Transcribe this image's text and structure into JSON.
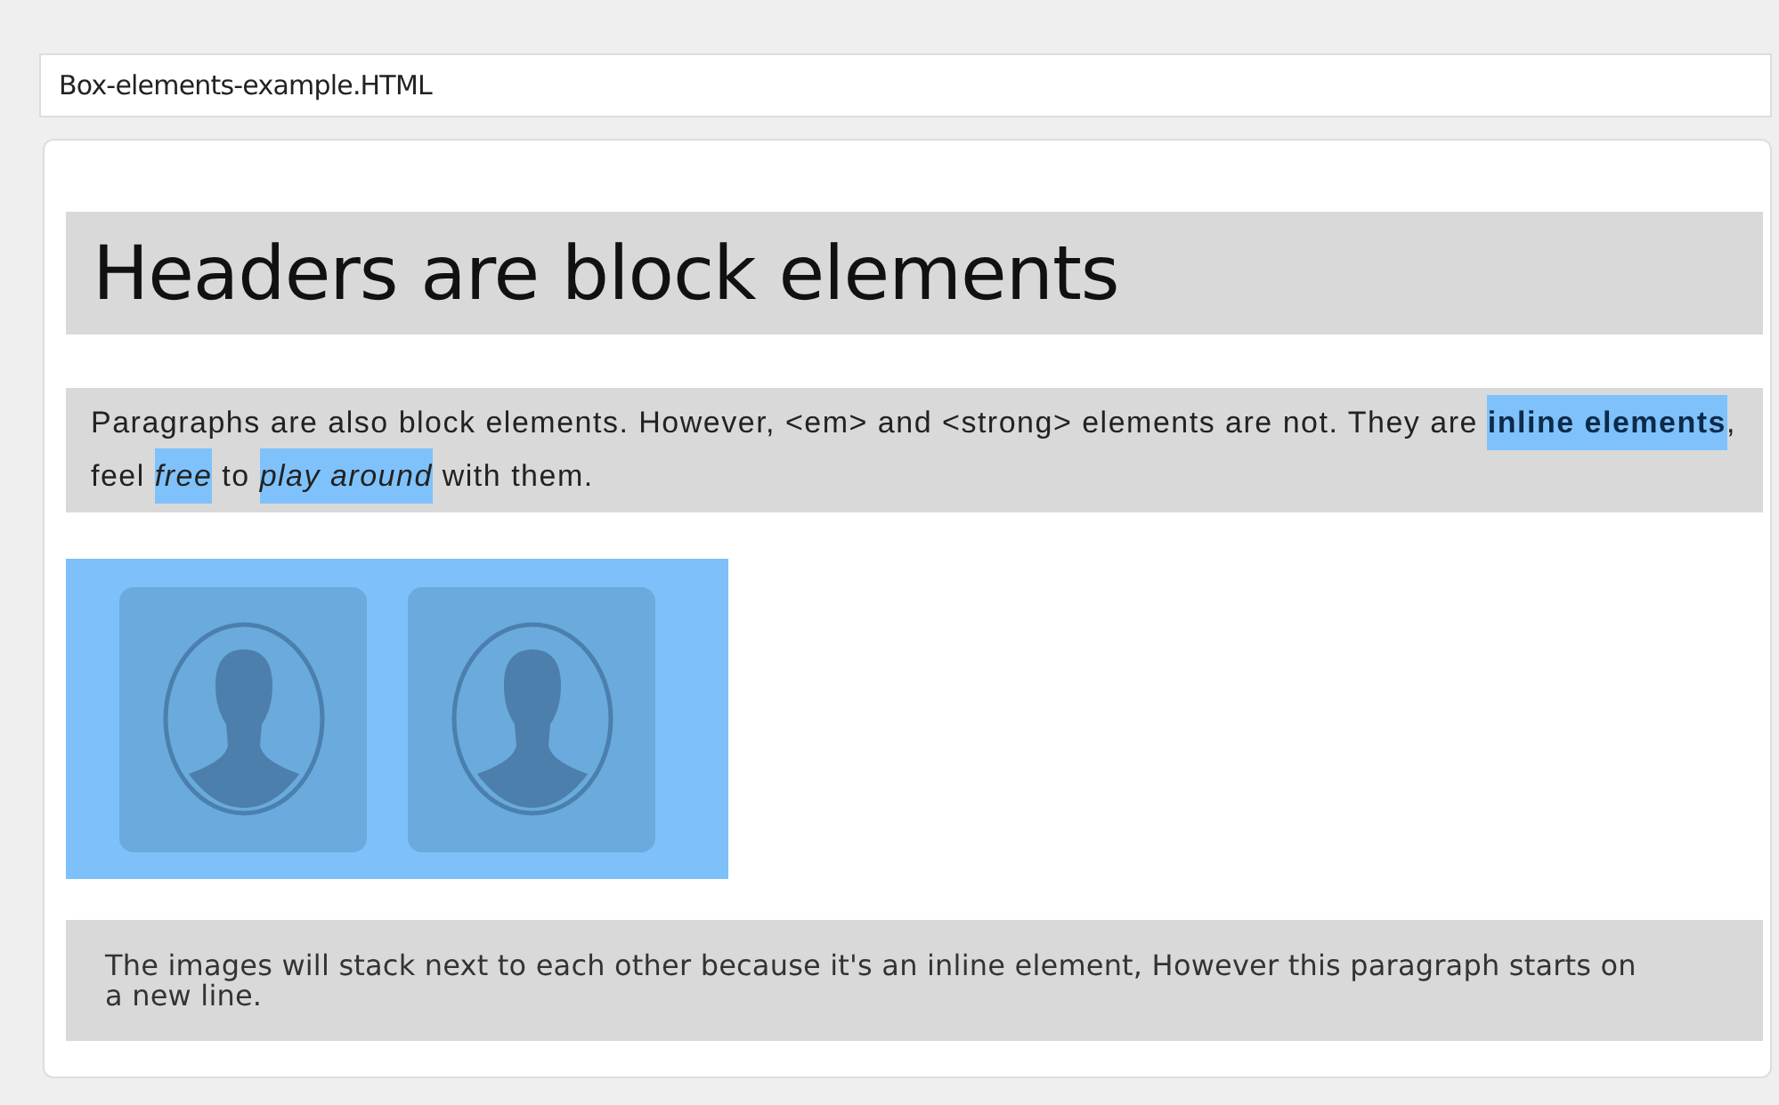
{
  "file_bar": {
    "title": "Box-elements-example.HTML"
  },
  "heading": "Headers are block elements",
  "paragraph": [
    {
      "text": "Paragraphs are also block elements. However, <em> and <strong> elements are not. They are ",
      "kind": "plain",
      "highlighted": false
    },
    {
      "text": "inline elements",
      "kind": "bold",
      "highlighted": true
    },
    {
      "text": ", feel ",
      "kind": "plain",
      "highlighted": false
    },
    {
      "text": "free",
      "kind": "italic",
      "highlighted": true
    },
    {
      "text": " to ",
      "kind": "plain",
      "highlighted": false
    },
    {
      "text": "play around",
      "kind": "italic",
      "highlighted": true
    },
    {
      "text": " with them.",
      "kind": "plain",
      "highlighted": false
    }
  ],
  "images": [
    {
      "kind": "avatar"
    },
    {
      "kind": "avatar"
    }
  ],
  "note": "The images will stack next to each other because it's an inline element, However this paragraph starts on a new line."
}
